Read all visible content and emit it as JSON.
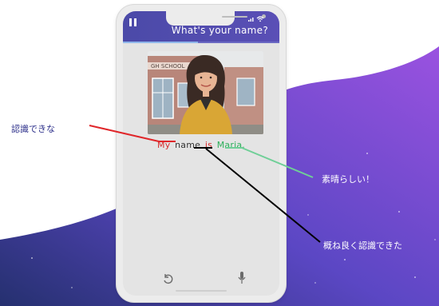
{
  "app": {
    "header_title": "What's your name?",
    "progress_fraction": 0.48
  },
  "scene": {
    "building_sign": "GH SCHOOL"
  },
  "sentence": {
    "words": [
      {
        "text": "My",
        "color": "#d62b2b"
      },
      {
        "text": "name",
        "color": "#333333"
      },
      {
        "text": "is",
        "color": "#d62b2b"
      },
      {
        "text": "Maria.",
        "color": "#2eaf5a"
      }
    ]
  },
  "controls": {
    "replay_icon": "replay-icon",
    "mic_icon": "microphone-icon"
  },
  "annotations": {
    "red_label": "認識できな",
    "green_label": "素晴らしい！",
    "black_label": "概ね良く認識できた"
  },
  "colors": {
    "accent_purple": "#4b4aa8",
    "wave_purple": "#8a4fd8",
    "wave_dark": "#2f3a8c",
    "red_line": "#e0262a",
    "green_line": "#6fcf97",
    "black_line": "#000000"
  }
}
